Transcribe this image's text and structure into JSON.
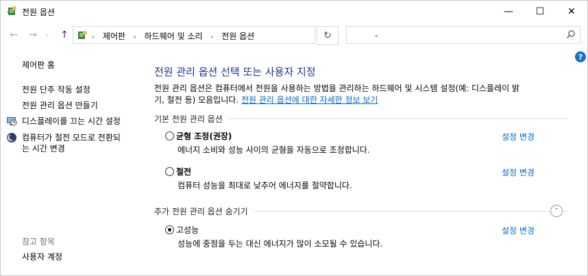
{
  "window": {
    "title": "전원 옵션",
    "minimize_glyph": "—",
    "maximize_glyph": "☐",
    "close_glyph": "✕"
  },
  "nav": {
    "back_glyph": "←",
    "forward_glyph": "→",
    "recent_glyph": "⌄",
    "up_glyph": "↑",
    "breadcrumbs": [
      "제어판",
      "하드웨어 및 소리",
      "전원 옵션"
    ],
    "breadcrumb_separator": "›",
    "dropdown_glyph": "⌄",
    "refresh_glyph": "↻",
    "search_value": "",
    "search_placeholder": ""
  },
  "help": {
    "label": "?"
  },
  "sidebar": {
    "home": "제어판 홈",
    "links": [
      {
        "label": "전원 단추 작동 설정",
        "icon": null
      },
      {
        "label": "전원 관리 옵션 만들기",
        "icon": null
      },
      {
        "label": "디스플레이를 끄는 시간 설정",
        "icon": "display-clock-icon"
      },
      {
        "label_line1": "컴퓨터가 절전 모드로 전환되",
        "label_line2": "는 시간 변경",
        "icon": "moon-sleep-icon"
      }
    ],
    "see_also_title": "참고 항목",
    "see_also": [
      "사용자 계정"
    ]
  },
  "main": {
    "heading": "전원 관리 옵션 선택 또는 사용자 지정",
    "description_line1": "전원 관리 옵션은 컴퓨터에서 전원을 사용하는 방법을 관리하는 하드웨어 및 시스템 설정(예: 디스플레이 밝",
    "description_line2_prefix": "기, 절전 등) 모음입니다. ",
    "description_link": "전원 관리 옵션에 대한 자세한 정보 보기",
    "basic_section_title": "기본 전원 관리 옵션",
    "extra_section_title": "추가 전원 관리 옵션 숨기기",
    "collapse_glyph": "⌃",
    "plans": [
      {
        "name": "균형 조정(권장)",
        "description": "에너지 소비와 성능 사이의 균형을 자동으로 조정합니다.",
        "link": "설정 변경",
        "selected": false
      },
      {
        "name": "절전",
        "description": "컴퓨터 성능을 최대로 낮추어 에너지를 절약합니다.",
        "link": "설정 변경",
        "selected": false
      },
      {
        "name": "고성능",
        "description": "성능에 중점을 두는 대신 에너지가 많이 소모될 수 있습니다.",
        "link": "설정 변경",
        "selected": true
      }
    ]
  },
  "colors": {
    "heading": "#1e3287",
    "link": "#0066cc",
    "muted": "#6d6d6d",
    "help": "#1a6fc8"
  }
}
